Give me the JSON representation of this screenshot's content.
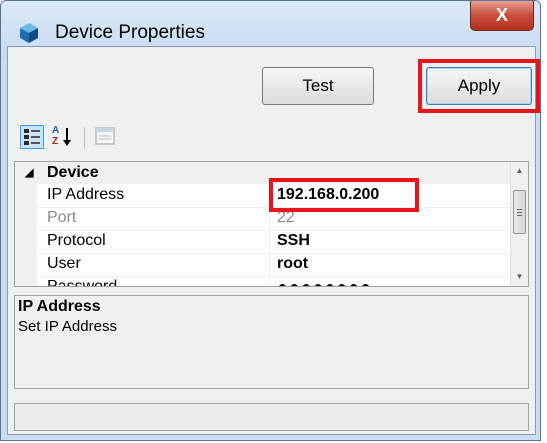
{
  "window": {
    "title": "Device Properties",
    "close_label": "X"
  },
  "buttons": {
    "test_label": "Test",
    "apply_label": "Apply"
  },
  "toolbar": {
    "icons": [
      "categorized-view-icon",
      "alphabetical-sort-icon",
      "property-pages-icon"
    ],
    "alpha_top": "A",
    "alpha_bottom": "Z"
  },
  "property_grid": {
    "category": "Device",
    "properties": [
      {
        "name": "IP Address",
        "value": "192.168.0.200",
        "enabled": true
      },
      {
        "name": "Port",
        "value": "22",
        "enabled": false
      },
      {
        "name": "Protocol",
        "value": "SSH",
        "enabled": true
      },
      {
        "name": "User",
        "value": "root",
        "enabled": true
      },
      {
        "name": "Password",
        "value": "●●●●●●●●",
        "enabled": true
      }
    ]
  },
  "help": {
    "title": "IP Address",
    "description": "Set IP Address"
  },
  "colors": {
    "highlight": "#e8141c",
    "title_bar": "#c9dcf1",
    "close_button": "#c74d3a"
  }
}
